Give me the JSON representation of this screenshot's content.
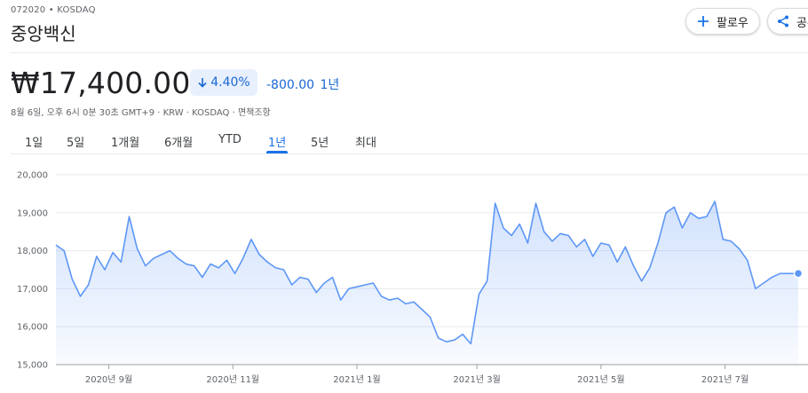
{
  "header": {
    "ticker": "072020 • KOSDAQ",
    "name": "중앙백신",
    "follow_label": "팔로우",
    "share_label": "공유"
  },
  "quote": {
    "price": "₩17,400.00",
    "change_pct": "4.40%",
    "change_abs": "-800.00",
    "period": "1년",
    "meta": "8월 6일, 오후 6시 0분 30초 GMT+9 · KRW · KOSDAQ · 면책조항"
  },
  "tabs": [
    "1일",
    "5일",
    "1개월",
    "6개월",
    "YTD",
    "1년",
    "5년",
    "최대"
  ],
  "active_tab": "1년",
  "colors": {
    "accent": "#1a73e8",
    "line": "#5e97f6",
    "down": "#1967d2"
  },
  "chart_data": {
    "type": "area",
    "ylim": [
      15000,
      20000
    ],
    "yticks": [
      "20,000",
      "19,000",
      "18,000",
      "17,000",
      "16,000",
      "15,000"
    ],
    "ytick_values": [
      20000,
      19000,
      18000,
      17000,
      16000,
      15000
    ],
    "xticks": [
      "2020년 9월",
      "2020년 11월",
      "2021년 1월",
      "2021년 3월",
      "2021년 5월",
      "2021년 7월"
    ],
    "x": [
      "2020-08-06",
      "2020-08-10",
      "2020-08-14",
      "2020-08-18",
      "2020-08-22",
      "2020-08-26",
      "2020-08-30",
      "2020-09-03",
      "2020-09-07",
      "2020-09-11",
      "2020-09-15",
      "2020-09-19",
      "2020-09-23",
      "2020-09-27",
      "2020-10-01",
      "2020-10-05",
      "2020-10-09",
      "2020-10-13",
      "2020-10-17",
      "2020-10-21",
      "2020-10-25",
      "2020-10-29",
      "2020-11-02",
      "2020-11-06",
      "2020-11-10",
      "2020-11-14",
      "2020-11-18",
      "2020-11-22",
      "2020-11-26",
      "2020-11-30",
      "2020-12-04",
      "2020-12-08",
      "2020-12-12",
      "2020-12-16",
      "2020-12-20",
      "2020-12-24",
      "2020-12-28",
      "2021-01-01",
      "2021-01-05",
      "2021-01-09",
      "2021-01-13",
      "2021-01-17",
      "2021-01-21",
      "2021-01-25",
      "2021-01-29",
      "2021-02-02",
      "2021-02-06",
      "2021-02-10",
      "2021-02-14",
      "2021-02-18",
      "2021-02-22",
      "2021-02-26",
      "2021-03-02",
      "2021-03-06",
      "2021-03-10",
      "2021-03-14",
      "2021-03-18",
      "2021-03-22",
      "2021-03-26",
      "2021-03-30",
      "2021-04-03",
      "2021-04-07",
      "2021-04-11",
      "2021-04-15",
      "2021-04-19",
      "2021-04-23",
      "2021-04-27",
      "2021-05-01",
      "2021-05-05",
      "2021-05-09",
      "2021-05-13",
      "2021-05-17",
      "2021-05-21",
      "2021-05-25",
      "2021-05-29",
      "2021-06-02",
      "2021-06-06",
      "2021-06-10",
      "2021-06-14",
      "2021-06-18",
      "2021-06-22",
      "2021-06-26",
      "2021-06-30",
      "2021-07-04",
      "2021-07-08",
      "2021-07-12",
      "2021-07-16",
      "2021-07-20",
      "2021-07-24",
      "2021-07-28",
      "2021-08-01",
      "2021-08-06"
    ],
    "series": [
      {
        "values": [
          18150,
          18000,
          17250,
          16800,
          17100,
          17850,
          17500,
          17950,
          17700,
          18900,
          18050,
          17600,
          17800,
          17900,
          18000,
          17800,
          17650,
          17600,
          17300,
          17650,
          17550,
          17750,
          17400,
          17800,
          18300,
          17900,
          17700,
          17550,
          17500,
          17100,
          17300,
          17250,
          16900,
          17150,
          17300,
          16700,
          17000,
          17050,
          17100,
          17150,
          16800,
          16700,
          16750,
          16600,
          16650,
          16450,
          16250,
          15700,
          15600,
          15650,
          15800,
          15550,
          16850,
          17200,
          19250,
          18600,
          18400,
          18700,
          18200,
          19250,
          18500,
          18250,
          18450,
          18400,
          18100,
          18300,
          17850,
          18200,
          18150,
          17700,
          18100,
          17600,
          17200,
          17550,
          18200,
          19000,
          19150,
          18600,
          19000,
          18850,
          18900,
          19300,
          18300,
          18250,
          18050,
          17750,
          17000,
          17150,
          17300,
          17400,
          17400,
          17400
        ]
      }
    ]
  }
}
